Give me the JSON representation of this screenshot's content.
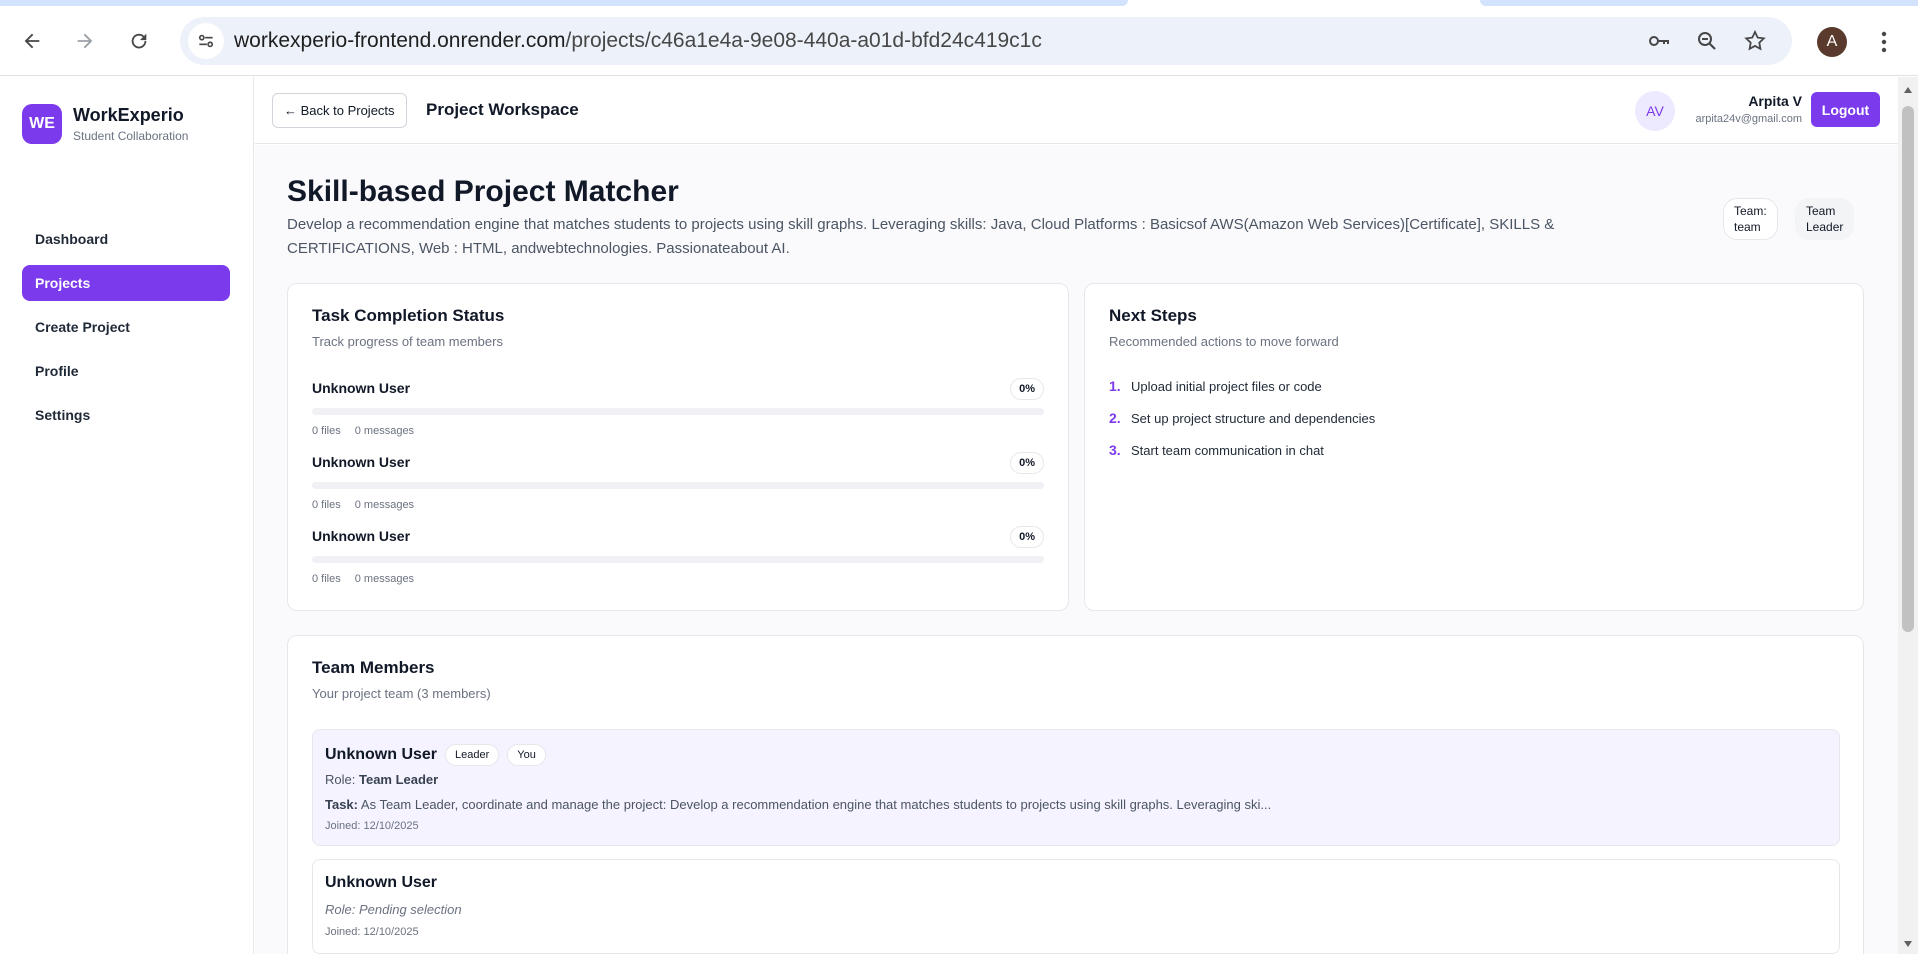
{
  "browser": {
    "url_host": "workexperio-frontend.onrender.com",
    "url_path": "/projects/c46a1e4a-9e08-440a-a01d-bfd24c419c1c",
    "profile_initial": "A"
  },
  "sidebar": {
    "brand_logo": "WE",
    "brand_name": "WorkExperio",
    "brand_sub": "Student Collaboration",
    "items": [
      {
        "label": "Dashboard"
      },
      {
        "label": "Projects"
      },
      {
        "label": "Create Project"
      },
      {
        "label": "Profile"
      },
      {
        "label": "Settings"
      }
    ]
  },
  "topbar": {
    "back_label": "← Back to Projects",
    "title": "Project Workspace",
    "avatar": "AV",
    "user_name": "Arpita V",
    "user_email": "arpita24v@gmail.com",
    "logout_label": "Logout"
  },
  "project": {
    "title": "Skill-based Project Matcher",
    "description": "Develop a recommendation engine that matches students to projects using skill graphs. Leveraging skills: Java, Cloud Platforms : Basicsof AWS(Amazon Web Services)[Certificate], SKILLS & CERTIFICATIONS, Web : HTML, andwebtechnologies. Passionateabout AI.",
    "badge_team_line1": "Team:",
    "badge_team_line2": "team",
    "badge_role_line1": "Team",
    "badge_role_line2": "Leader"
  },
  "task_status": {
    "title": "Task Completion Status",
    "subtitle": "Track progress of team members",
    "rows": [
      {
        "name": "Unknown User",
        "percent_label": "0%",
        "progress": 0,
        "files": "0 files",
        "messages": "0 messages"
      },
      {
        "name": "Unknown User",
        "percent_label": "0%",
        "progress": 0,
        "files": "0 files",
        "messages": "0 messages"
      },
      {
        "name": "Unknown User",
        "percent_label": "0%",
        "progress": 0,
        "files": "0 files",
        "messages": "0 messages"
      }
    ]
  },
  "next_steps": {
    "title": "Next Steps",
    "subtitle": "Recommended actions to move forward",
    "items": [
      {
        "num": "1.",
        "text": "Upload initial project files or code"
      },
      {
        "num": "2.",
        "text": "Set up project structure and dependencies"
      },
      {
        "num": "3.",
        "text": "Start team communication in chat"
      }
    ]
  },
  "team": {
    "title": "Team Members",
    "subtitle": "Your project team (3 members)",
    "members": [
      {
        "name": "Unknown User",
        "chip1": "Leader",
        "chip2": "You",
        "role_label": "Role:",
        "role": "Team Leader",
        "task_label": "Task:",
        "task": "As Team Leader, coordinate and manage the project: Develop a recommendation engine that matches students to projects using skill graphs. Leveraging ski...",
        "joined": "Joined: 12/10/2025"
      },
      {
        "name": "Unknown User",
        "role_pending": "Role: Pending selection",
        "joined": "Joined: 12/10/2025"
      }
    ]
  },
  "colors": {
    "accent": "#7c3aed",
    "accent_light": "#ede9fe",
    "member_highlight": "#f5f3ff"
  }
}
